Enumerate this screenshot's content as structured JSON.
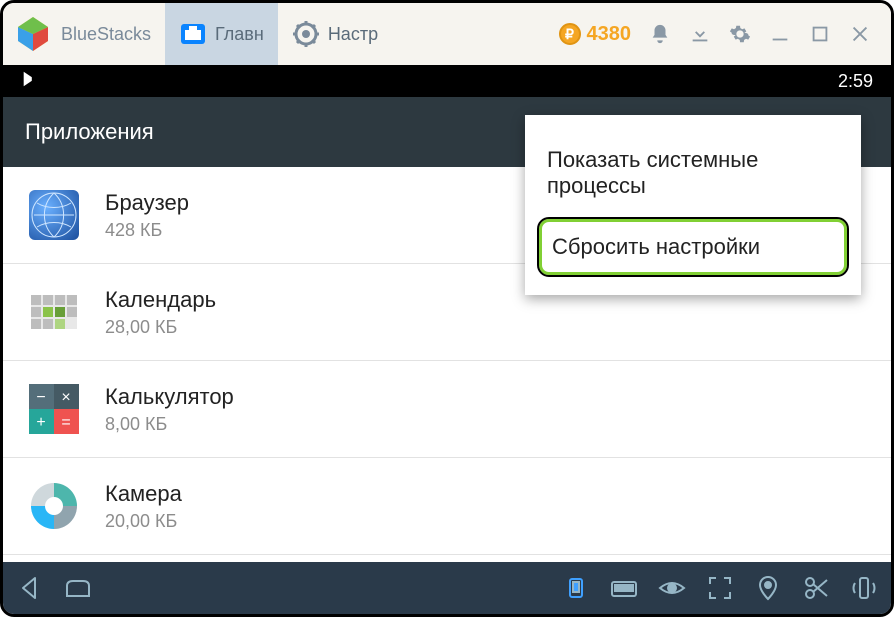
{
  "titlebar": {
    "app_name": "BlueStacks",
    "tabs": [
      {
        "label": "Главн"
      },
      {
        "label": "Настр"
      }
    ],
    "coin_value": "4380"
  },
  "statusbar": {
    "time": "2:59"
  },
  "header": {
    "title": "Приложения"
  },
  "apps": [
    {
      "name": "Браузер",
      "size": "428 КБ"
    },
    {
      "name": "Календарь",
      "size": "28,00 КБ"
    },
    {
      "name": "Калькулятор",
      "size": "8,00 КБ"
    },
    {
      "name": "Камера",
      "size": "20,00 КБ"
    }
  ],
  "popup": {
    "item1": "Показать системные процессы",
    "item2": "Сбросить настройки"
  }
}
